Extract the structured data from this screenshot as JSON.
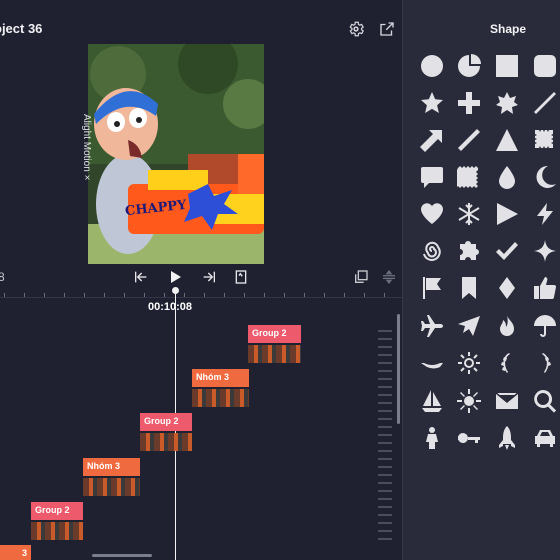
{
  "project": {
    "title": "oject 36",
    "dots": "..."
  },
  "preview": {
    "watermark": "Alight Motion ×",
    "sticker_text": "CHAPPY"
  },
  "transport": {
    "current_time_left": "8",
    "playhead_time": "00:10:08"
  },
  "timeline": {
    "clips": [
      {
        "label": "Group 2",
        "color": "#ec5a6c"
      },
      {
        "label": "Nhóm 3",
        "color": "#ef6a3f"
      },
      {
        "label": "Group 2",
        "color": "#ec5a6c"
      },
      {
        "label": "Nhóm 3",
        "color": "#ef6a3f"
      },
      {
        "label": "Group 2",
        "color": "#ec5a6c"
      },
      {
        "label": "3",
        "color": "#ef6a3f"
      }
    ]
  },
  "shape_panel": {
    "title": "Shape",
    "shapes": [
      "circle-icon",
      "pie-icon",
      "square-icon",
      "rounded-square-icon",
      "star-icon",
      "plus-icon",
      "star-badge-icon",
      "line-icon",
      "arrow-diagonal-icon",
      "line-thick-icon",
      "triangle-icon",
      "stamp-icon",
      "speech-bubble-icon",
      "stamp-square-icon",
      "drop-icon",
      "crescent-icon",
      "heart-icon",
      "snowflake-icon",
      "play-triangle-icon",
      "lightning-icon",
      "spiral-icon",
      "puzzle-icon",
      "checkmark-icon",
      "sparkle-icon",
      "flag-icon",
      "bookmark-icon",
      "diamond-icon",
      "thumbs-up-icon",
      "airplane-icon",
      "paper-plane-icon",
      "flame-icon",
      "umbrella-icon",
      "banner-icon",
      "sun-outline-icon",
      "laurel-icon",
      "laurel-right-icon",
      "sailboat-icon",
      "sun-icon",
      "envelope-icon",
      "search-icon",
      "person-icon",
      "key-icon",
      "rocket-icon",
      "car-icon"
    ]
  },
  "colors": {
    "accent_group": "#ec5a6c",
    "accent_nhom": "#ef6a3f",
    "panel_bg": "#292b3a",
    "timeline_bg": "#1f2130"
  }
}
